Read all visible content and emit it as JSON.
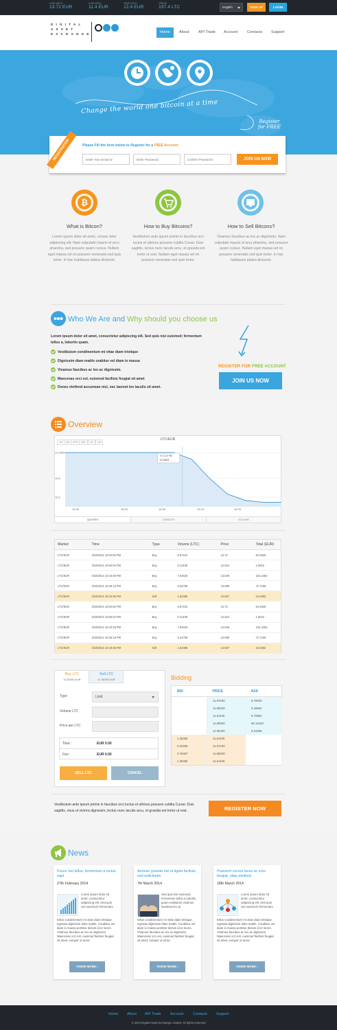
{
  "topbar": {
    "stats": [
      {
        "label": "Last price",
        "value": "13.72 EUR"
      },
      {
        "label": "Low price",
        "value": "11.4 EUR"
      },
      {
        "label": "High price",
        "value": "12.4 EUR"
      },
      {
        "label": "Volum",
        "value": "197.4 LTC"
      }
    ],
    "language": "English",
    "signup": "SIGN UP",
    "login": "LOGIN"
  },
  "logo": {
    "line1": "DIGITAL",
    "line2": "ASSET",
    "line3": "EXCHANGE",
    "dot_colors": [
      "#1e2a33",
      "#2d9ad6",
      "#2d9ad6"
    ]
  },
  "nav": [
    "Home",
    "About",
    "API Trade",
    "Account",
    "Contacts",
    "Support"
  ],
  "hero": {
    "tagline": "Change the world one bitcoin at a time",
    "register_line1": "Register",
    "register_line2": "for FREE",
    "icons": [
      "clock-icon",
      "globe-icon",
      "location-pin-icon"
    ]
  },
  "registration": {
    "ribbon": "REGISTRATION",
    "title_prefix": "Please Fill the form below to Register for a",
    "title_highlight": "FREE Account",
    "email_placeholder": "Enter Your Email Id",
    "password_placeholder": "Enter Password",
    "confirm_placeholder": "Confirm Password",
    "join_label": "JOIN US NOW"
  },
  "features": [
    {
      "title": "What is Bitcon?",
      "text": "Lorem ipsum dolor sit amet, consec tetur adipiscing elit. Nam vulputate mauris id arcu pharetra, sed posuere quam cursus. Nullam eget massa vel mi posuere venenatis sed quis tortor. In hac habitasse platea dictumst.",
      "color": "#f7941d"
    },
    {
      "title": "How to Buy Bitcoins?",
      "text": "Vestibulum ante ipsum primis in faucibus orci luctus et ultrices posuere cubilia Curae; Duis sagittis, lectus nunc iaculis arcu, et gravida est tortor ut erat. Nullam eget massa vel mi posuere venenatis sed quis tortor.",
      "color": "#8dc63f"
    },
    {
      "title": "How to Sell Bitcons?",
      "text": "Vivamus faucibus ac leo ac dignissim. Nam vulputate mauris id arcu pharetra, sed posuere quam cursus. Nullam eget massa vel mi posuere venenatis sed quis tortor. In hac habitasse platea dictumst.",
      "color": "#6fc1ea"
    }
  ],
  "who": {
    "title_a": "Who We Are and",
    "title_b": "Why should you choose us",
    "intro": "Lorem ipsum dolor sit amet, consectetur adipiscing elit. Sed quis nisi euismod; fermentum tellus a, lobortis quam.",
    "checks": [
      "Vestibulum condimentum mi vitae diam tristique",
      "Dignissim diam mattis urabitur vel diam in massa",
      "Vivamus faucibus ac leo ac dignissim.",
      "Maecenas orci est, euismod facilisis feugiat sit amet",
      "Donec eleifend accumsan nisl, nec laoreet leo iaculis sit amet."
    ],
    "reg_a": "REGISTER FOR",
    "reg_b": "FREE ACCOUNT",
    "join_label": "JOIN US NOW"
  },
  "overview": {
    "title": "Overview",
    "zoom_tabs": [
      "1M",
      "5M",
      "MTD",
      "30D",
      "1D",
      "1W"
    ],
    "bottom_tabs": [
      "QUOTES",
      "CANDLES",
      "VOLUME"
    ]
  },
  "chart_data": {
    "type": "area",
    "title": "LTC/EUR",
    "x_ticks": [
      "15:45",
      "16:00",
      "16:05",
      "16:15",
      "16:25"
    ],
    "y_ticks": [
      "12.2009",
      "11.8",
      "11.5"
    ],
    "tooltip": {
      "time": "● 13.20 PM",
      "value": "12.0503"
    },
    "series": [
      {
        "values": [
          12.2009,
          12.2009,
          12.2009,
          12.2009,
          12.2009,
          12.2009,
          12.2009,
          12.1,
          11.8,
          11.55,
          11.45,
          11.42,
          11.42
        ]
      }
    ],
    "color": "#4a9fd8"
  },
  "trades": {
    "headers": [
      "Market",
      "Time",
      "Type",
      "Volume (LTC)",
      "Price",
      "Total (EUR)"
    ],
    "rows": [
      [
        "LTC/EUR",
        "3/18/2014 10:54:50 PM",
        "Buy",
        "6.87191",
        "13.72",
        "94.2826"
      ],
      [
        "LTC/EUR",
        "3/18/2014 10:50:04 PM",
        "Buy",
        "0.11408",
        "13.624",
        "1.5542"
      ],
      [
        "LTC/EUR",
        "3/18/2014 10:43:48 PM",
        "Buy",
        "7.54633",
        "13.549",
        "102.2452"
      ],
      [
        "LTC/EUR",
        "3/18/2014 10:36:13 PM",
        "Buy",
        "5.34759",
        "13.598",
        "72.7165"
      ],
      [
        "LTC/EUR",
        "3/18/2014 10:23:35 PM",
        "Sell",
        "1.82485",
        "13.507",
        "24.6482"
      ],
      [
        "LTC/EUR",
        "3/18/2014 10:54:50 PM",
        "Buy",
        "6.87191",
        "13.72",
        "94.2826"
      ],
      [
        "LTC/EUR",
        "3/18/2014 10:50:04 PM",
        "Buy",
        "0.11408",
        "13.624",
        "1.5542"
      ],
      [
        "LTC/EUR",
        "3/18/2014 10:43:48 PM",
        "Buy",
        "7.54633",
        "13.549",
        "102.2452"
      ],
      [
        "LTC/EUR",
        "3/18/2014 10:36:13 PM",
        "Buy",
        "5.34759",
        "13.598",
        "72.7165"
      ],
      [
        "LTC/EUR",
        "3/18/2014 10:23:35 PM",
        "Sell",
        "1.82485",
        "13.507",
        "24.6482"
      ]
    ],
    "highlight_rows": [
      4,
      9
    ]
  },
  "trade_form": {
    "buy_tab": "Buy LTC",
    "buy_sub": "11.50200 EUR",
    "sell_tab": "Sell LTC",
    "sell_sub": "11.38100 EUR",
    "type_label": "Type",
    "type_value": "Limit",
    "volume_label": "Volume LTC",
    "price_label": "Price per LTC",
    "total_label": "Total :",
    "total_value": "EUR 0.00",
    "fee_label": "Fee :",
    "fee_value": "EUR 0.00",
    "sell_button": "SELL LTC",
    "cancel_button": "CANCEL"
  },
  "bidding": {
    "title": "Bidding",
    "headers": [
      "BID",
      "PRICE",
      "ASK"
    ],
    "rows": [
      [
        "",
        "11.87000",
        "5.79003"
      ],
      [
        "",
        "11.86000",
        "0.29962"
      ],
      [
        "",
        "11.81100",
        "5.70862"
      ],
      [
        "",
        "11.80000",
        "56.10440"
      ],
      [
        "",
        "11.80400",
        "0.24306"
      ],
      [
        "1.35484",
        "11.61100",
        ""
      ],
      [
        "0.23305",
        "11.57100",
        ""
      ],
      [
        "0.78467",
        "11.55000",
        ""
      ],
      [
        "1.35484",
        "11.61100",
        ""
      ]
    ]
  },
  "cta": {
    "text": "Vestibulum ante ipsum primis in faucibus orci luctus et ultrices posuere cubilia Curae; Duis sagittis, risus ut viverra dignissim, lectus nunc iaculis arcu, et gravida est tortor ut erat.",
    "button": "REGISTER NOW"
  },
  "news": {
    "title": "News",
    "items": [
      {
        "title": "Fusce nisi tellus, fermentum a luctus eget",
        "date": "27th February 2014",
        "summary": "Lorem ipsum dolor sit amet, consectetur adipiscing elit. Sed quis nisi euismod; fermentum",
        "body": "tellus condimentum mi vitae diam tristique. egestas dignissim diam mattis. Curabitur vel diam in massa porttitor dictum id et lorem. Vivamus faucibus ac leo ac dignissim. Maecenas orci est, euismod facilisis feugiat sit amet, semper ut tortor.",
        "more": "KNOW MORE",
        "thumb": "bar-chart-thumbnail"
      },
      {
        "title": "Aenean gravida nisl ut ligula facilisis, sed sollicitudin",
        "date": "7th March 2014",
        "summary": "Sed quis nisi euismod; fermentum tellus a lobortis quam estibulum vivamus faucibus leo ac",
        "body": "tellus condimentum mi vitae diam tristique. egestas dignissim diam mattis. Curabitur vel diam in massa porttitor dictum id et lorem. Vivamus faucibus ac leo ac dignissim. Maecenas orci est, euismod facilisis feugiat sit amet, semper ut tortor.",
        "more": "KNOW MORE",
        "thumb": "handshake-thumbnail"
      },
      {
        "title": "Praesent cursus lacus ac eros feugiat, vitae eleifend",
        "date": "18th March 2014",
        "summary": "Lorem ipsum dolor sit amet, consectetur adipiscing elit. Sed quis nisi euismod; fermentum",
        "body": "tellus condimentum mi vitae diam tristique. egestas dignissim diam mattis. Curabitur vel diam in massa porttitor dictum id et lorem. Vivamus faucibus ac leo ac dignissim. Maecenas orci est, euismod facilisis feugiat sit amet, semper ut tortor.",
        "more": "KNOW MORE",
        "thumb": "people-network-thumbnail"
      }
    ]
  },
  "footer": {
    "nav": [
      "Home",
      "About",
      "API Trade",
      "Account",
      "Contacts",
      "Support"
    ],
    "copyright": "© 2014 Digital Asset Exchange Limited. All rights reserved"
  }
}
